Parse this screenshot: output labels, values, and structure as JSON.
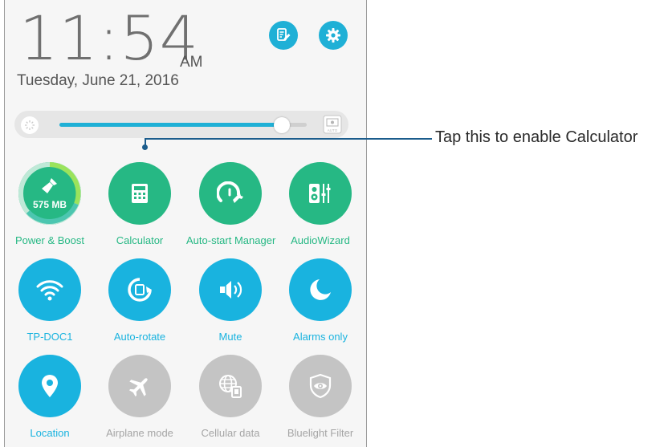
{
  "clock": {
    "time": "11:54",
    "ampm": "AM",
    "date": "Tuesday, June 21, 2016"
  },
  "brightness": {
    "level": 0.9
  },
  "colors": {
    "accent_blue": "#19b3df",
    "accent_green": "#26b884",
    "disabled_gray": "#c4c4c4",
    "callout": "#1b5c8c"
  },
  "tiles": {
    "power_boost": {
      "label": "Power & Boost",
      "value": "575 MB",
      "icon": "broom-icon"
    },
    "calculator": {
      "label": "Calculator",
      "icon": "calculator-icon"
    },
    "autostart": {
      "label": "Auto-start Manager",
      "icon": "speedometer-wrench-icon"
    },
    "audiowizard": {
      "label": "AudioWizard",
      "icon": "speaker-equalizer-icon"
    },
    "wifi": {
      "label": "TP-DOC1",
      "icon": "wifi-icon"
    },
    "autorotate": {
      "label": "Auto-rotate",
      "icon": "rotate-icon"
    },
    "mute": {
      "label": "Mute",
      "icon": "speaker-icon"
    },
    "alarms": {
      "label": "Alarms only",
      "icon": "moon-icon"
    },
    "location": {
      "label": "Location",
      "icon": "location-pin-icon"
    },
    "airplane": {
      "label": "Airplane mode",
      "icon": "airplane-icon"
    },
    "cellular": {
      "label": "Cellular data",
      "icon": "globe-signal-icon"
    },
    "bluelight": {
      "label": "Bluelight Filter",
      "icon": "eye-shield-icon"
    }
  },
  "callout": {
    "text": "Tap this to enable Calculator"
  }
}
